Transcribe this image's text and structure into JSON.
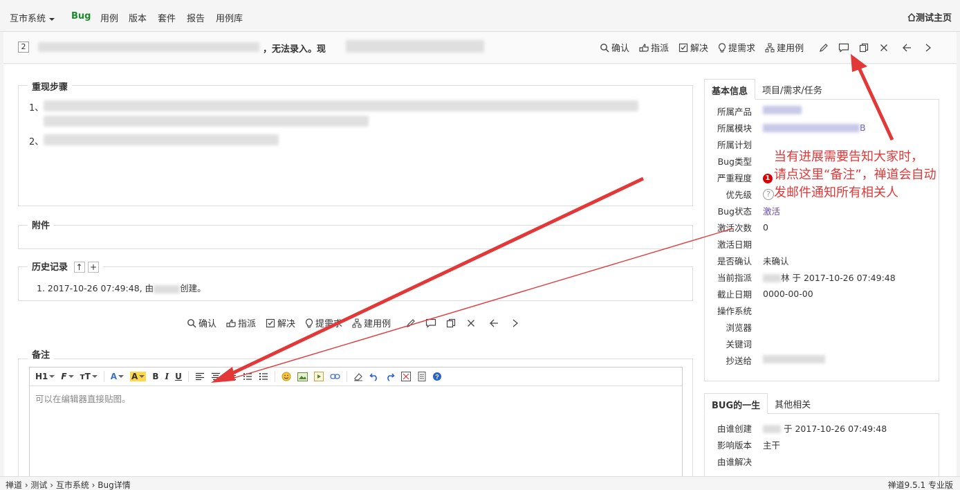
{
  "nav": {
    "items": [
      "互市系统",
      "Bug",
      "用例",
      "版本",
      "套件",
      "报告",
      "用例库"
    ],
    "home": "测试主页"
  },
  "bug": {
    "id": "2",
    "title_tail": "，无法录入。现"
  },
  "actions": {
    "confirm": "确认",
    "assign": "指派",
    "resolve": "解决",
    "story": "提需求",
    "case": "建用例"
  },
  "sections": {
    "steps": "重现步骤",
    "step1": "1、",
    "step2": "2、",
    "attachments": "附件",
    "history": "历史记录",
    "history_line": "1. 2017-10-26 07:49:48, 由",
    "history_tail": "创建。",
    "comment": "备注",
    "editor_placeholder": "可以在编辑器直接贴图。"
  },
  "editor_toolbar": {
    "heading": "H1",
    "font": "F",
    "size": "тT",
    "color": "A",
    "bg": "A",
    "bold": "B",
    "italic": "I",
    "underline": "U"
  },
  "side": {
    "tab1": "基本信息",
    "tab2": "项目/需求/任务",
    "fields": [
      {
        "k": "所属产品",
        "v": ""
      },
      {
        "k": "所属模块",
        "v": "B"
      },
      {
        "k": "所属计划",
        "v": ""
      },
      {
        "k": "Bug类型",
        "v": ""
      },
      {
        "k": "严重程度",
        "v": "1"
      },
      {
        "k": "优先级",
        "v": "?"
      },
      {
        "k": "Bug状态",
        "v": "激活"
      },
      {
        "k": "激活次数",
        "v": "0"
      },
      {
        "k": "激活日期",
        "v": ""
      },
      {
        "k": "是否确认",
        "v": "未确认"
      },
      {
        "k": "当前指派",
        "v": "林 于 2017-10-26 07:49:48"
      },
      {
        "k": "截止日期",
        "v": "0000-00-00"
      },
      {
        "k": "操作系统",
        "v": ""
      },
      {
        "k": "浏览器",
        "v": ""
      },
      {
        "k": "关键词",
        "v": ""
      },
      {
        "k": "抄送给",
        "v": ""
      }
    ],
    "tab3": "BUG的一生",
    "tab4": "其他相关",
    "life": [
      {
        "k": "由谁创建",
        "v": "于 2017-10-26 07:49:48"
      },
      {
        "k": "影响版本",
        "v": "主干"
      },
      {
        "k": "由谁解决",
        "v": ""
      }
    ]
  },
  "annotation": {
    "line1": "当有进展需要告知大家时，",
    "line2": "请点这里“备注”，禅道会自动",
    "line3": "发邮件通知所有相关人"
  },
  "bottom": {
    "crumbs": "禅道 › 测试 › 互市系统 › Bug详情",
    "version": "禅道9.5.1 专业版"
  },
  "colors": {
    "accent_green": "#1a8a2a",
    "annotation_red": "#e23838",
    "status_purple": "#6a4ba8"
  }
}
